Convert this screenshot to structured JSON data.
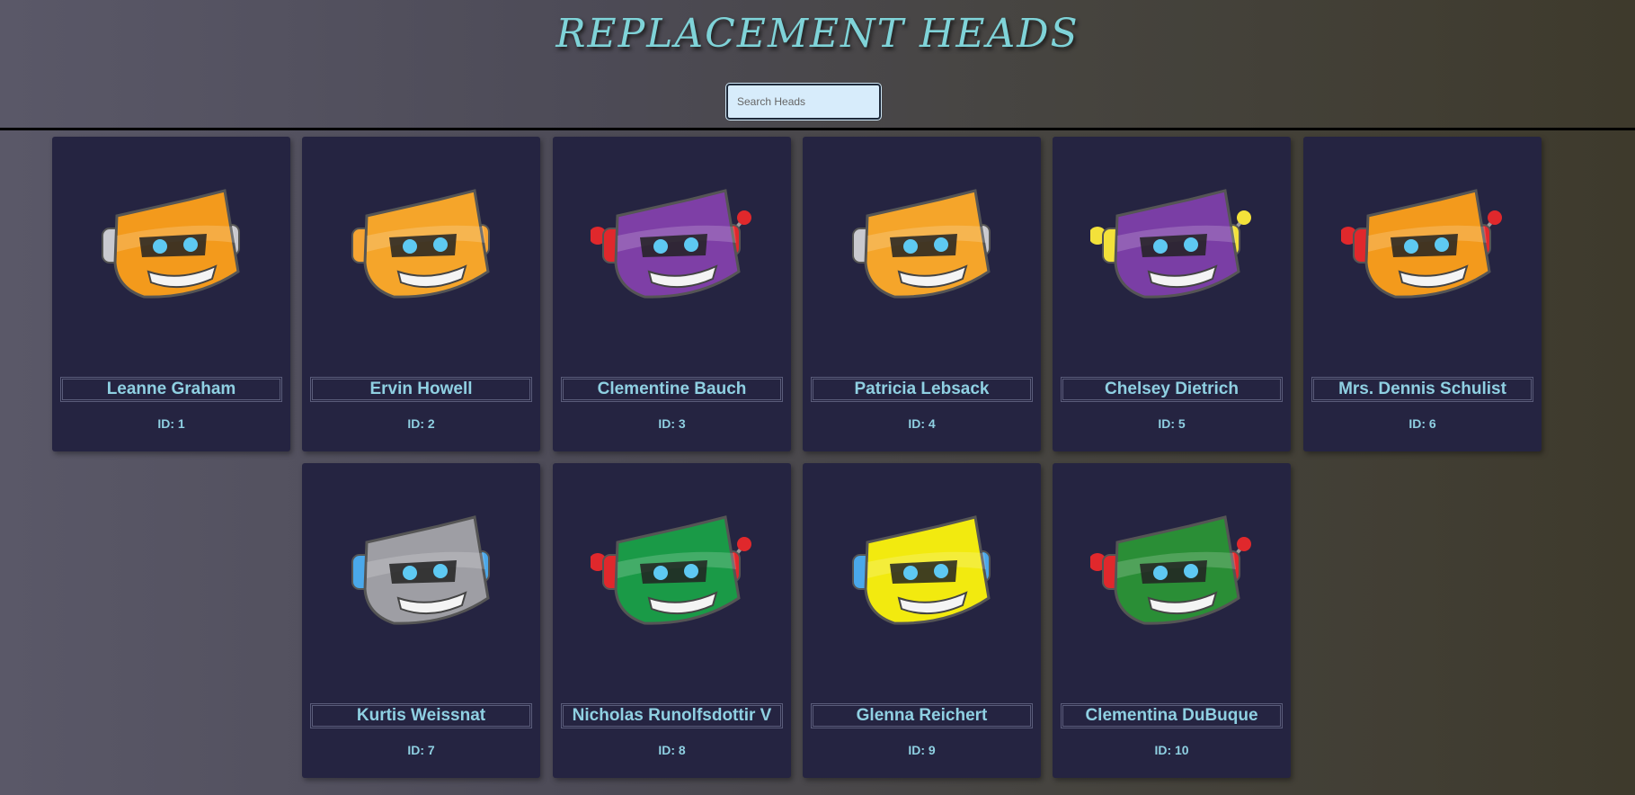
{
  "header": {
    "title": "REPLACEMENT HEADS",
    "search_placeholder": "Search Heads"
  },
  "cards": [
    {
      "name": "Leanne Graham",
      "id": "ID: 1",
      "color": "#f39a1c",
      "ears": "silver",
      "antenna": false
    },
    {
      "name": "Ervin Howell",
      "id": "ID: 2",
      "color": "#f5a52a",
      "ears": "orange",
      "antenna": false
    },
    {
      "name": "Clementine Bauch",
      "id": "ID: 3",
      "color": "#7e3fa6",
      "ears": "red",
      "antenna": true
    },
    {
      "name": "Patricia Lebsack",
      "id": "ID: 4",
      "color": "#f5a52a",
      "ears": "silver",
      "antenna": false
    },
    {
      "name": "Chelsey Dietrich",
      "id": "ID: 5",
      "color": "#7a3ea5",
      "ears": "yellow",
      "antenna": true
    },
    {
      "name": "Mrs. Dennis Schulist",
      "id": "ID: 6",
      "color": "#f39a1c",
      "ears": "red",
      "antenna": true
    },
    {
      "name": "Kurtis Weissnat",
      "id": "ID: 7",
      "color": "#9e9ea4",
      "ears": "blue",
      "antenna": false
    },
    {
      "name": "Nicholas Runolfsdottir V",
      "id": "ID: 8",
      "color": "#1a9a47",
      "ears": "red",
      "antenna": true
    },
    {
      "name": "Glenna Reichert",
      "id": "ID: 9",
      "color": "#f2ea0f",
      "ears": "blue",
      "antenna": false
    },
    {
      "name": "Clementina DuBuque",
      "id": "ID: 10",
      "color": "#2a8e36",
      "ears": "red",
      "antenna": true
    }
  ]
}
